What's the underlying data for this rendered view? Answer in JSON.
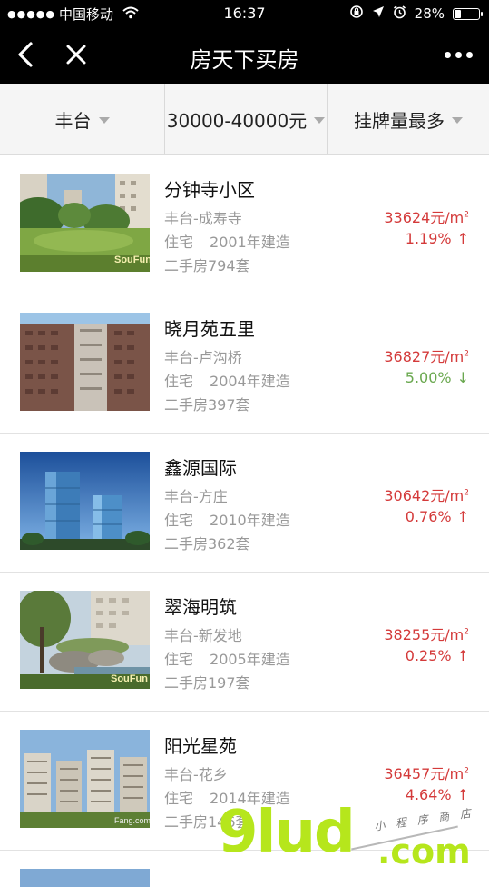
{
  "status_bar": {
    "carrier": "中国移动",
    "time": "16:37",
    "battery": "28%",
    "battery_level": 0.28
  },
  "nav": {
    "title": "房天下买房"
  },
  "filters": {
    "district": "丰台",
    "price_range": "30000-40000元",
    "sort": "挂牌量最多"
  },
  "listings": [
    {
      "name": "分钟寺小区",
      "area": "丰台-成寿寺",
      "type": "住宅",
      "built": "2001年建造",
      "count": "二手房794套",
      "price": "33624元/m",
      "price_sup": "2",
      "change": "1.19%",
      "trend": "up",
      "arrow": "↑",
      "image": "garden-courtyard",
      "watermark": "SouFun"
    },
    {
      "name": "晓月苑五里",
      "area": "丰台-卢沟桥",
      "type": "住宅",
      "built": "2004年建造",
      "count": "二手房397套",
      "price": "36827元/m",
      "price_sup": "2",
      "change": "5.00%",
      "trend": "down",
      "arrow": "↓",
      "image": "residential-tower"
    },
    {
      "name": "鑫源国际",
      "area": "丰台-方庄",
      "type": "住宅",
      "built": "2010年建造",
      "count": "二手房362套",
      "price": "30642元/m",
      "price_sup": "2",
      "change": "0.76%",
      "trend": "up",
      "arrow": "↑",
      "image": "glass-towers"
    },
    {
      "name": "翠海明筑",
      "area": "丰台-新发地",
      "type": "住宅",
      "built": "2005年建造",
      "count": "二手房197套",
      "price": "38255元/m",
      "price_sup": "2",
      "change": "0.25%",
      "trend": "up",
      "arrow": "↑",
      "image": "rock-garden-pond",
      "watermark": "SouFun"
    },
    {
      "name": "阳光星苑",
      "area": "丰台-花乡",
      "type": "住宅",
      "built": "2014年建造",
      "count": "二手房146套",
      "price": "36457元/m",
      "price_sup": "2",
      "change": "4.64%",
      "trend": "up",
      "arrow": "↑",
      "image": "apartment-blocks",
      "watermark": "Fang.com"
    }
  ],
  "watermark": {
    "big": "9lud",
    "suffix": ".com",
    "small": "小 程 序 商 店"
  }
}
